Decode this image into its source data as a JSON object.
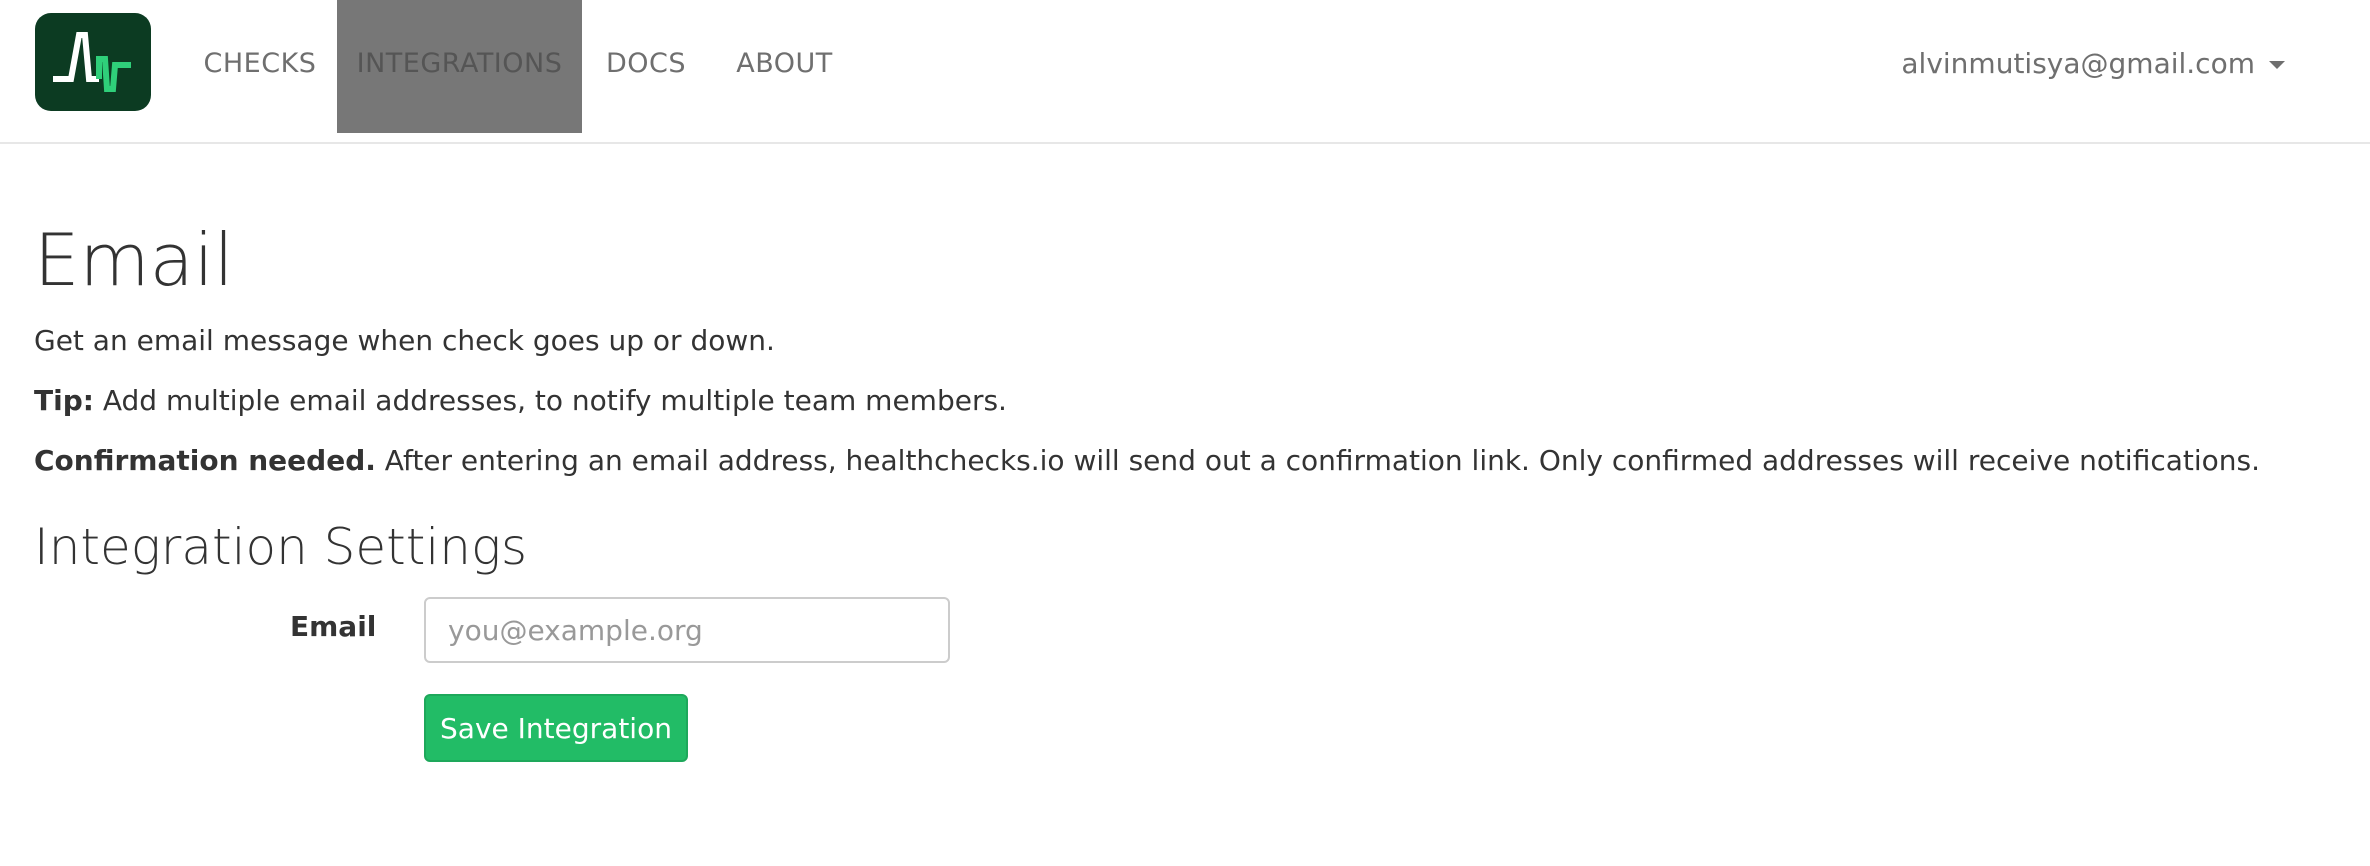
{
  "nav": {
    "logo_name": "healthchecks-logo",
    "items": [
      {
        "label": "CHECKS",
        "active": false
      },
      {
        "label": "INTEGRATIONS",
        "active": true
      },
      {
        "label": "DOCS",
        "active": false
      },
      {
        "label": "ABOUT",
        "active": false
      }
    ],
    "user_email": "alvinmutisya@gmail.com",
    "user_icon": "caret-down-icon"
  },
  "page": {
    "title": "Email",
    "description": "Get an email message when check goes up or down.",
    "tip_label": "Tip:",
    "tip_text": " Add multiple email addresses, to notify multiple team members.",
    "confirm_label": "Confirmation needed.",
    "confirm_text": " After entering an email address, healthchecks.io will send out a confirmation link. Only confirmed addresses will receive notifications.",
    "settings_heading": "Integration Settings"
  },
  "form": {
    "email_label": "Email",
    "email_value": "",
    "email_placeholder": "you@example.org",
    "save_label": "Save Integration"
  },
  "colors": {
    "accent": "#22bc66",
    "logo_bg": "#0c3b22",
    "active_nav_bg": "#777777"
  }
}
